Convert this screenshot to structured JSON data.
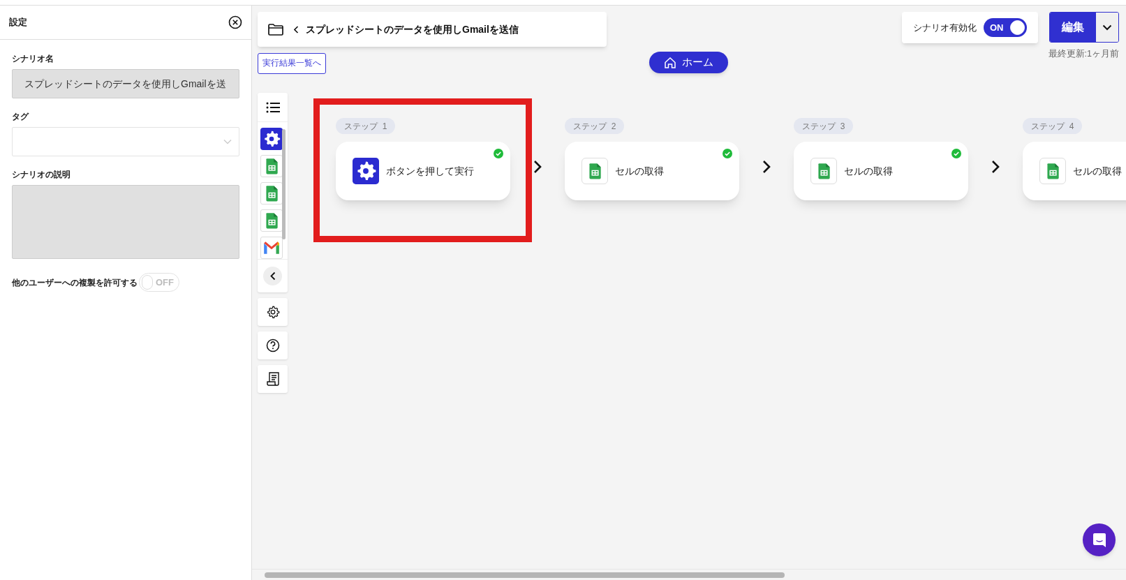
{
  "settings_panel": {
    "title": "設定",
    "fields": [
      {
        "kind": "text",
        "label": "シナリオ名",
        "value": "スプレッドシートのデータを使用しGmailを送"
      },
      {
        "kind": "select",
        "label": "タグ"
      },
      {
        "kind": "textarea",
        "label": "シナリオの説明"
      }
    ],
    "copy_permission": {
      "label": "他のユーザーへの複製を許可する",
      "on": false,
      "state_text": "OFF"
    }
  },
  "header": {
    "scenario_title": "スプレッドシートのデータを使用しGmailを送信",
    "results_link": "実行結果一覧へ",
    "home_button": "ホーム",
    "enable": {
      "label": "シナリオ有効化",
      "on": true,
      "state_text": "ON"
    },
    "edit_button": "編集",
    "last_updated": "最終更新:1ヶ月前"
  },
  "toolbar": {
    "step_icons": [
      {
        "kind": "trigger"
      },
      {
        "kind": "sheets"
      },
      {
        "kind": "sheets"
      },
      {
        "kind": "sheets"
      },
      {
        "kind": "gmail"
      }
    ]
  },
  "steps": [
    {
      "label": "ステップ  1",
      "title": "ボタンを押して実行",
      "kind": "trigger",
      "completed": true
    },
    {
      "label": "ステップ  2",
      "title": "セルの取得",
      "kind": "sheets",
      "completed": true
    },
    {
      "label": "ステップ  3",
      "title": "セルの取得",
      "kind": "sheets",
      "completed": true
    },
    {
      "label": "ステップ  4",
      "title": "セルの取得",
      "kind": "sheets"
    }
  ]
}
